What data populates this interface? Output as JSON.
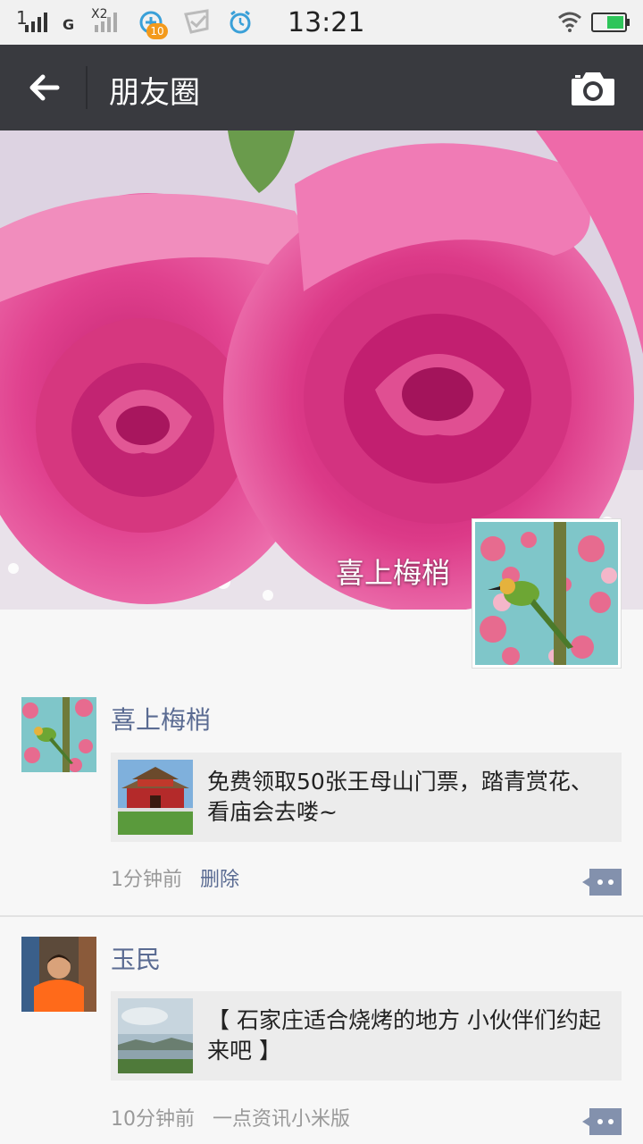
{
  "status_bar": {
    "signal1": "1",
    "signal2": "G",
    "signal3": "X2",
    "badge_count": "10",
    "time": "13:21"
  },
  "header": {
    "title": "朋友圈",
    "back_icon": "back-arrow-icon",
    "camera_icon": "camera-icon"
  },
  "cover": {
    "user_name": "喜上梅梢"
  },
  "posts": [
    {
      "author": "喜上梅梢",
      "link_text": "免费领取50张王母山门票，踏青赏花、看庙会去喽~",
      "time": "1分钟前",
      "action": "删除"
    },
    {
      "author": "玉民",
      "link_text": "【 石家庄适合烧烤的地方 小伙伴们约起来吧 】",
      "time": "10分钟前",
      "source": "一点资讯小米版"
    }
  ],
  "colors": {
    "header_bg": "#393a3f",
    "name_link": "#5a6b92",
    "link_box": "#ececec"
  }
}
